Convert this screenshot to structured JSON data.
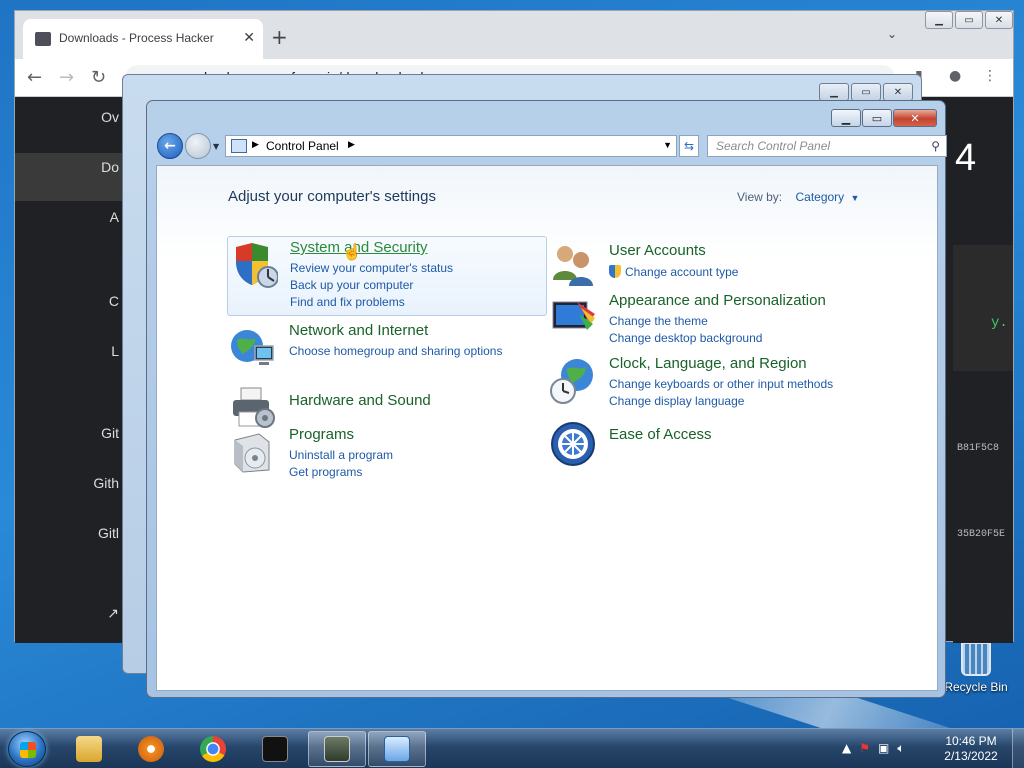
{
  "browser": {
    "tab_title": "Downloads - Process Hacker",
    "new_tab": "+",
    "tab_close": "✕",
    "url": "processhacker.sourceforge.io/downloads.php",
    "left_nav": [
      "Ov",
      "Do",
      "A",
      "C",
      "L",
      "Git",
      "Gith",
      "Gitl"
    ],
    "right_big": "4",
    "right_green": "y.",
    "right_hash_1": "B81F5C8",
    "right_hash_2": "35B20F5E"
  },
  "control_panel": {
    "breadcrumb": "Control Panel",
    "search_placeholder": "Search Control Panel",
    "heading": "Adjust your computer's settings",
    "view_by_label": "View by:",
    "view_by_value": "Category",
    "categories": [
      {
        "title": "System and Security",
        "links": [
          "Review your computer's status",
          "Back up your computer",
          "Find and fix problems"
        ]
      },
      {
        "title": "Network and Internet",
        "links": [
          "Choose homegroup and sharing options"
        ]
      },
      {
        "title": "Hardware and Sound",
        "links": []
      },
      {
        "title": "Programs",
        "links": [
          "Uninstall a program",
          "Get programs"
        ]
      },
      {
        "title": "User Accounts",
        "links": [
          "Change account type"
        ]
      },
      {
        "title": "Appearance and Personalization",
        "links": [
          "Change the theme",
          "Change desktop background"
        ]
      },
      {
        "title": "Clock, Language, and Region",
        "links": [
          "Change keyboards or other input methods",
          "Change display language"
        ]
      },
      {
        "title": "Ease of Access",
        "links": []
      }
    ]
  },
  "desktop": {
    "recycle_bin": "Recycle Bin"
  },
  "taskbar": {
    "time": "10:46 PM",
    "date": "2/13/2022"
  }
}
